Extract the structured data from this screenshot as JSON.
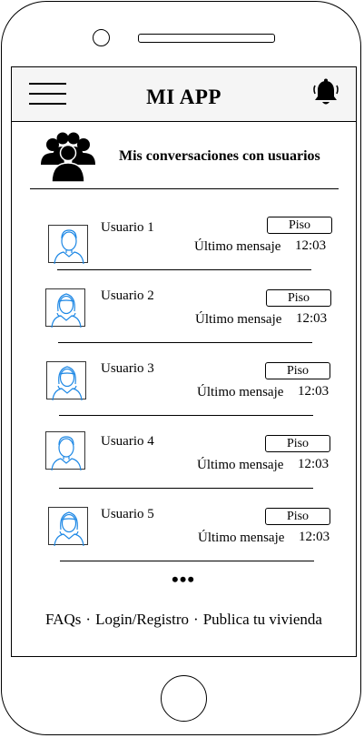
{
  "header": {
    "title": "MI APP",
    "menu_icon": "hamburger-menu-icon",
    "notification_icon": "bell-icon"
  },
  "section": {
    "title": "Mis conversaciones con usuarios",
    "icon": "group-users-icon"
  },
  "conversations": [
    {
      "name": "Usuario 1",
      "tag": "Piso",
      "last_message": "Último mensaje",
      "time": "12:03",
      "avatar": "male-user-icon"
    },
    {
      "name": "Usuario 2",
      "tag": "Piso",
      "last_message": "Último mensaje",
      "time": "12:03",
      "avatar": "female-user-icon"
    },
    {
      "name": "Usuario 3",
      "tag": "Piso",
      "last_message": "Último mensaje",
      "time": "12:03",
      "avatar": "female-user-icon"
    },
    {
      "name": "Usuario 4",
      "tag": "Piso",
      "last_message": "Último mensaje",
      "time": "12:03",
      "avatar": "male-user-icon"
    },
    {
      "name": "Usuario 5",
      "tag": "Piso",
      "last_message": "Último mensaje",
      "time": "12:03",
      "avatar": "female-user-icon"
    }
  ],
  "more_indicator": "•••",
  "footer": {
    "links": [
      "FAQs",
      "Login/Registro",
      "Publica tu vivienda"
    ],
    "separator": "·"
  },
  "colors": {
    "header_bg": "#f5f5f5",
    "avatar_stroke": "#1e88e5"
  }
}
